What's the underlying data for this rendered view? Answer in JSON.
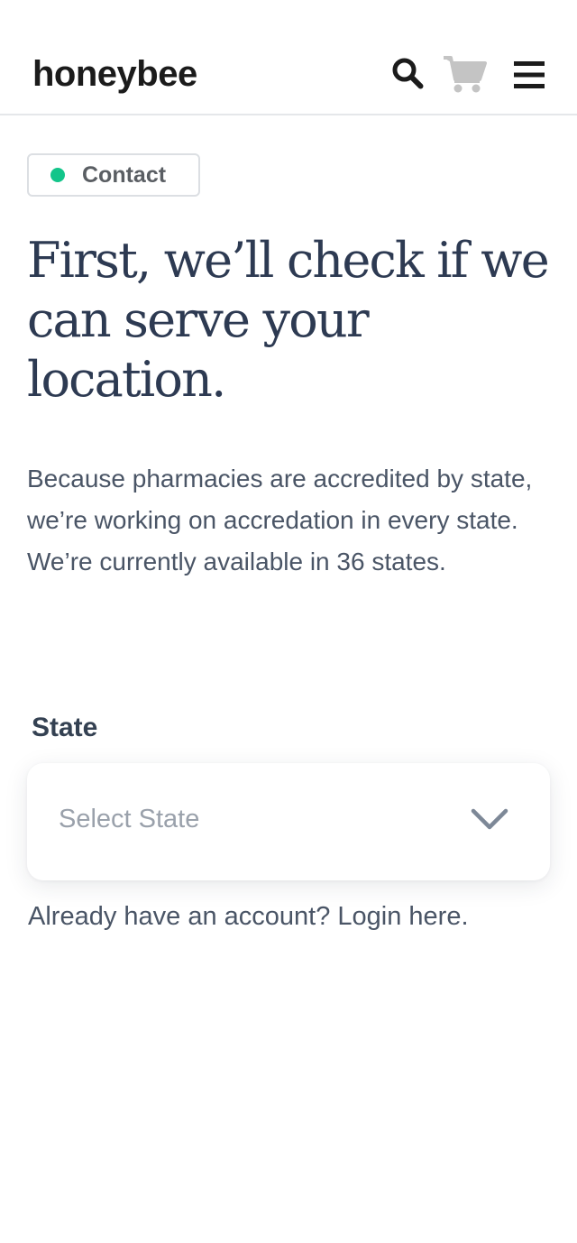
{
  "header": {
    "logo": "honeybee",
    "icons": {
      "search": "search-icon",
      "cart": "cart-icon",
      "menu": "hamburger-menu-icon"
    }
  },
  "badge": {
    "label": "Contact",
    "dot_color": "#13c58a"
  },
  "main": {
    "headline": "First, we’ll check if we can serve your location.",
    "body": "Because pharmacies are accredited by state, we’re working on accredation in every state. We’re currently available in 36 states."
  },
  "state_field": {
    "label": "State",
    "placeholder": "Select State"
  },
  "login": {
    "text": "Already have an account? Login here."
  },
  "colors": {
    "heading": "#2d3a52",
    "body_text": "#4a5566",
    "cart_icon": "#c4c4c4",
    "accent_green": "#13c58a"
  }
}
